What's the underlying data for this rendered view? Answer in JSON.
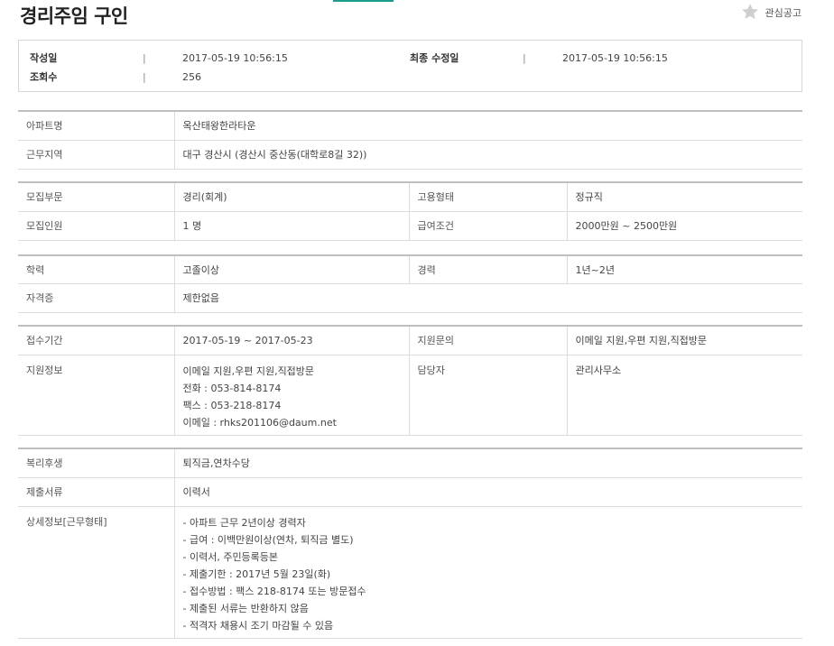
{
  "title": "경리주임 구인",
  "favorite_label": "관심공고",
  "meta": {
    "created_label": "작성일",
    "created_value": "2017-05-19 10:56:15",
    "modified_label": "최종 수정일",
    "modified_value": "2017-05-19 10:56:15",
    "views_label": "조회수",
    "views_value": "256",
    "separator": "|"
  },
  "section1": {
    "apt_label": "아파트명",
    "apt_value": "옥산태왕한라타운",
    "region_label": "근무지역",
    "region_value": "대구 경산시 (경산시 중산동(대학로8길 32))"
  },
  "section2": {
    "dept_label": "모집부문",
    "dept_value": "경리(회계)",
    "type_label": "고용형태",
    "type_value": "정규직",
    "count_label": "모집인원",
    "count_value": "1 명",
    "salary_label": "급여조건",
    "salary_value": "2000만원 ~ 2500만원"
  },
  "section3": {
    "edu_label": "학력",
    "edu_value": "고졸이상",
    "exp_label": "경력",
    "exp_value": "1년~2년",
    "cert_label": "자격증",
    "cert_value": "제한없음"
  },
  "section4": {
    "period_label": "접수기간",
    "period_value": "2017-05-19 ~ 2017-05-23",
    "inquiry_label": "지원문의",
    "inquiry_value": "이메일 지원,우편 지원,직접방문",
    "apply_label": "지원정보",
    "apply_lines": [
      "이메일 지원,우편 지원,직접방문",
      "전화 : 053-814-8174",
      "팩스 : 053-218-8174",
      "이메일 : rhks201106@daum.net"
    ],
    "contact_label": "담당자",
    "contact_value": "관리사무소"
  },
  "section5": {
    "welfare_label": "복리후생",
    "welfare_value": "퇴직금,연차수당",
    "docs_label": "제출서류",
    "docs_value": "이력서",
    "detail_label": "상세정보[근무형태]",
    "detail_lines": [
      "- 아파트 근무 2년이상 경력자",
      "- 급여 : 이백만원이상(연차, 퇴직금 별도)",
      "- 이력서, 주민등록등본",
      "- 제출기한 : 2017년 5월 23일(화)",
      "- 접수방법 : 팩스 218-8174 또는 방문접수",
      "- 제출된 서류는 반환하지 않음",
      "- 적격자 채용시 조기 마감될 수 있음"
    ]
  },
  "colors": {
    "accent": "#1a9c8c",
    "border": "#dcdcdc",
    "star": "#cfcfcf"
  }
}
